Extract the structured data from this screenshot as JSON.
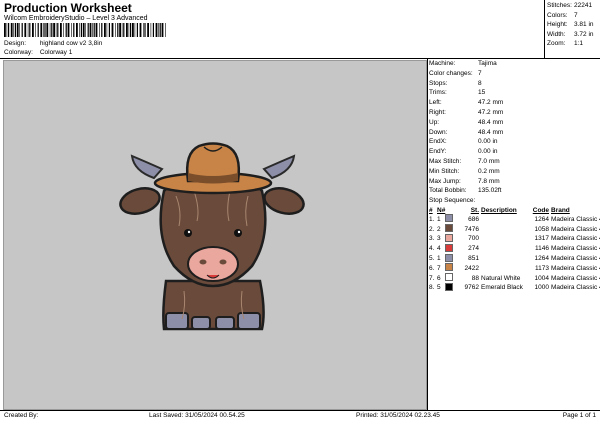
{
  "header": {
    "title": "Production Worksheet",
    "subtitle": "Wilcom EmbroideryStudio – Level 3 Advanced",
    "design_label": "Design:",
    "design_value": "highland cow v2 3,8in",
    "colorway_label": "Colorway:",
    "colorway_value": "Colorway 1"
  },
  "stats": [
    {
      "label": "Stitches:",
      "value": "22241"
    },
    {
      "label": "Colors:",
      "value": "7"
    },
    {
      "label": "Height:",
      "value": "3.81 in"
    },
    {
      "label": "Width:",
      "value": "3.72 in"
    },
    {
      "label": "Zoom:",
      "value": "1:1"
    }
  ],
  "machine_info": [
    {
      "label": "Machine:",
      "value": "Tajima"
    },
    {
      "label": "Color changes:",
      "value": "7"
    },
    {
      "label": "Stops:",
      "value": "8"
    },
    {
      "label": "Trims:",
      "value": "15"
    },
    {
      "label": "Left:",
      "value": "47.2 mm"
    },
    {
      "label": "Right:",
      "value": "47.2 mm"
    },
    {
      "label": "Up:",
      "value": "48.4 mm"
    },
    {
      "label": "Down:",
      "value": "48.4 mm"
    },
    {
      "label": "EndX:",
      "value": "0.00 in"
    },
    {
      "label": "EndY:",
      "value": "0.00 in"
    },
    {
      "label": "Max Stitch:",
      "value": "7.0 mm"
    },
    {
      "label": "Min Stitch:",
      "value": "0.2 mm"
    },
    {
      "label": "Max Jump:",
      "value": "7.8 mm"
    },
    {
      "label": "Total Bobbin:",
      "value": "135.02ft"
    }
  ],
  "stop_sequence": {
    "title": "Stop Sequence:",
    "columns": [
      "#",
      "N#",
      "",
      "St.",
      "Description",
      "Code",
      "Brand"
    ],
    "rows": [
      {
        "num": "1.",
        "n": "1",
        "color": "#8d8fa8",
        "st": "686",
        "desc": "",
        "code": "1264",
        "brand": "Madeira Classic 40"
      },
      {
        "num": "2.",
        "n": "2",
        "color": "#6a4a3a",
        "st": "7476",
        "desc": "",
        "code": "1058",
        "brand": "Madeira Classic 40"
      },
      {
        "num": "3.",
        "n": "3",
        "color": "#eaa79d",
        "st": "700",
        "desc": "",
        "code": "1317",
        "brand": "Madeira Classic 40"
      },
      {
        "num": "4.",
        "n": "4",
        "color": "#d93a3a",
        "st": "274",
        "desc": "",
        "code": "1146",
        "brand": "Madeira Classic 40"
      },
      {
        "num": "5.",
        "n": "1",
        "color": "#8d8fa8",
        "st": "851",
        "desc": "",
        "code": "1264",
        "brand": "Madeira Classic 40"
      },
      {
        "num": "6.",
        "n": "7",
        "color": "#c88447",
        "st": "2422",
        "desc": "",
        "code": "1173",
        "brand": "Madeira Classic 40"
      },
      {
        "num": "7.",
        "n": "6",
        "color": "#ffffff",
        "st": "88",
        "desc": "Natural White",
        "code": "1004",
        "brand": "Madeira Classic 40"
      },
      {
        "num": "8.",
        "n": "5",
        "color": "#000000",
        "st": "9762",
        "desc": "Emerald Black",
        "code": "1000",
        "brand": "Madeira Classic 40"
      }
    ]
  },
  "footer": {
    "created_by": "Created By:",
    "last_saved": "Last Saved: 31/05/2024 00.54.25",
    "printed": "Printed: 31/05/2024 02.23.45",
    "page": "Page 1 of 1"
  },
  "colors": {
    "canvas_bg": "#c6c6c6",
    "cow_fur": "#6a4a3a",
    "hat": "#c88447",
    "muzzle": "#eaa79d",
    "horn": "#8d8fa8"
  }
}
